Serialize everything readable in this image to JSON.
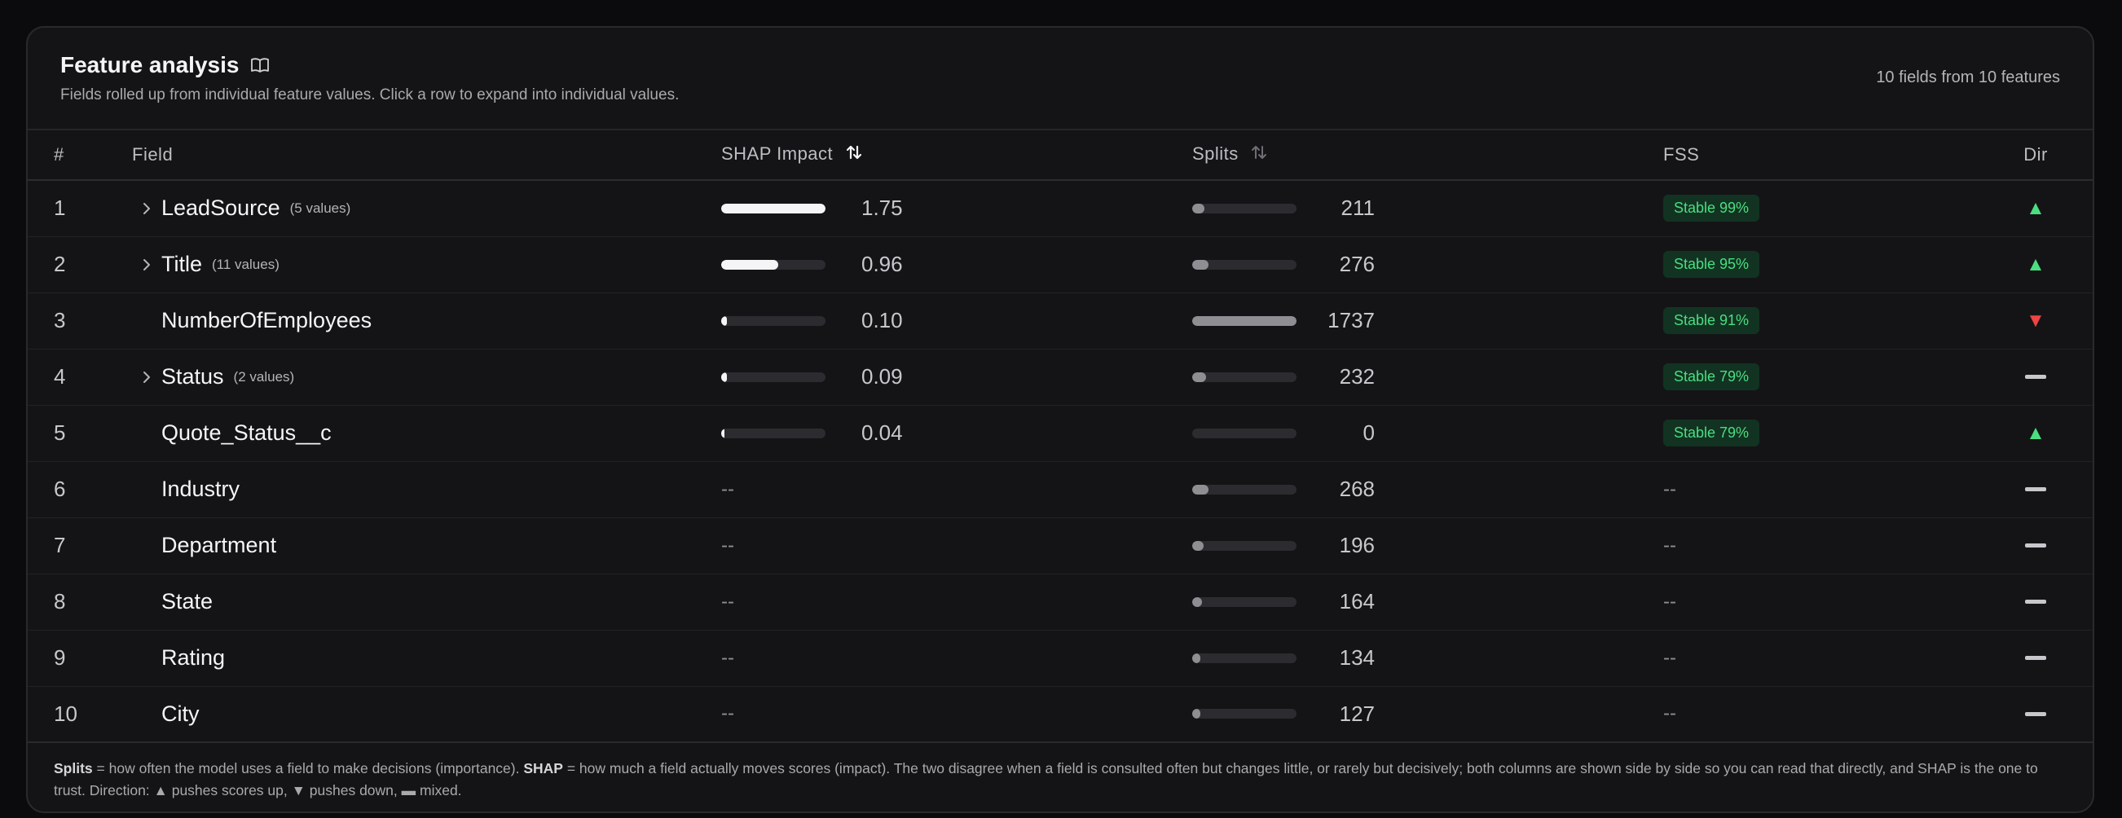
{
  "header": {
    "title": "Feature analysis",
    "subtitle": "Fields rolled up from individual feature values. Click a row to expand into individual values.",
    "summary": "10 fields from 10 features"
  },
  "columns": {
    "index": "#",
    "field": "Field",
    "shap": "SHAP Impact",
    "splits": "Splits",
    "fss": "FSS",
    "dir": "Dir"
  },
  "rows": [
    {
      "index": "1",
      "field": "LeadSource",
      "count": "(5 values)",
      "expandable": true,
      "shap": "1.75",
      "shap_fraction": 1.0,
      "splits": "211",
      "splits_fraction": 0.121,
      "fss": "Stable 99%",
      "dir": "up"
    },
    {
      "index": "2",
      "field": "Title",
      "count": "(11 values)",
      "expandable": true,
      "shap": "0.96",
      "shap_fraction": 0.549,
      "splits": "276",
      "splits_fraction": 0.159,
      "fss": "Stable 95%",
      "dir": "up"
    },
    {
      "index": "3",
      "field": "NumberOfEmployees",
      "count": "",
      "expandable": false,
      "shap": "0.10",
      "shap_fraction": 0.057,
      "splits": "1737",
      "splits_fraction": 1.0,
      "fss": "Stable 91%",
      "dir": "down"
    },
    {
      "index": "4",
      "field": "Status",
      "count": "(2 values)",
      "expandable": true,
      "shap": "0.09",
      "shap_fraction": 0.051,
      "splits": "232",
      "splits_fraction": 0.134,
      "fss": "Stable 79%",
      "dir": "mixed"
    },
    {
      "index": "5",
      "field": "Quote_Status__c",
      "count": "",
      "expandable": false,
      "shap": "0.04",
      "shap_fraction": 0.023,
      "splits": "0",
      "splits_fraction": 0.0,
      "fss": "Stable 79%",
      "dir": "up"
    },
    {
      "index": "6",
      "field": "Industry",
      "count": "",
      "expandable": false,
      "shap": "--",
      "shap_fraction": null,
      "splits": "268",
      "splits_fraction": 0.154,
      "fss": "--",
      "dir": "mixed"
    },
    {
      "index": "7",
      "field": "Department",
      "count": "",
      "expandable": false,
      "shap": "--",
      "shap_fraction": null,
      "splits": "196",
      "splits_fraction": 0.113,
      "fss": "--",
      "dir": "mixed"
    },
    {
      "index": "8",
      "field": "State",
      "count": "",
      "expandable": false,
      "shap": "--",
      "shap_fraction": null,
      "splits": "164",
      "splits_fraction": 0.094,
      "fss": "--",
      "dir": "mixed"
    },
    {
      "index": "9",
      "field": "Rating",
      "count": "",
      "expandable": false,
      "shap": "--",
      "shap_fraction": null,
      "splits": "134",
      "splits_fraction": 0.077,
      "fss": "--",
      "dir": "mixed"
    },
    {
      "index": "10",
      "field": "City",
      "count": "",
      "expandable": false,
      "shap": "--",
      "shap_fraction": null,
      "splits": "127",
      "splits_fraction": 0.073,
      "fss": "--",
      "dir": "mixed"
    }
  ],
  "footer": {
    "splits_term": "Splits",
    "splits_def": " = how often the model uses a field to make decisions (importance). ",
    "shap_term": "SHAP",
    "shap_def": " = how much a field actually moves scores (impact). The two disagree when a field is consulted often but changes little, or rarely but decisively; both columns are shown side by side so you can read that directly, and SHAP is the one to trust. Direction: ▲ pushes scores up, ▼ pushes down, ▬ mixed."
  },
  "colors": {
    "accent_green": "#4ade80",
    "accent_red": "#ef4444",
    "card_bg": "#141416",
    "badge_bg": "#123322"
  },
  "icons": {
    "title": "book-open-icon",
    "sort_active": "sort-arrows-icon",
    "sort_inactive": "sort-arrows-icon",
    "expand": "chevron-right-icon",
    "dir_up": "triangle-up-icon",
    "dir_down": "triangle-down-icon",
    "dir_mixed": "dash-icon"
  }
}
